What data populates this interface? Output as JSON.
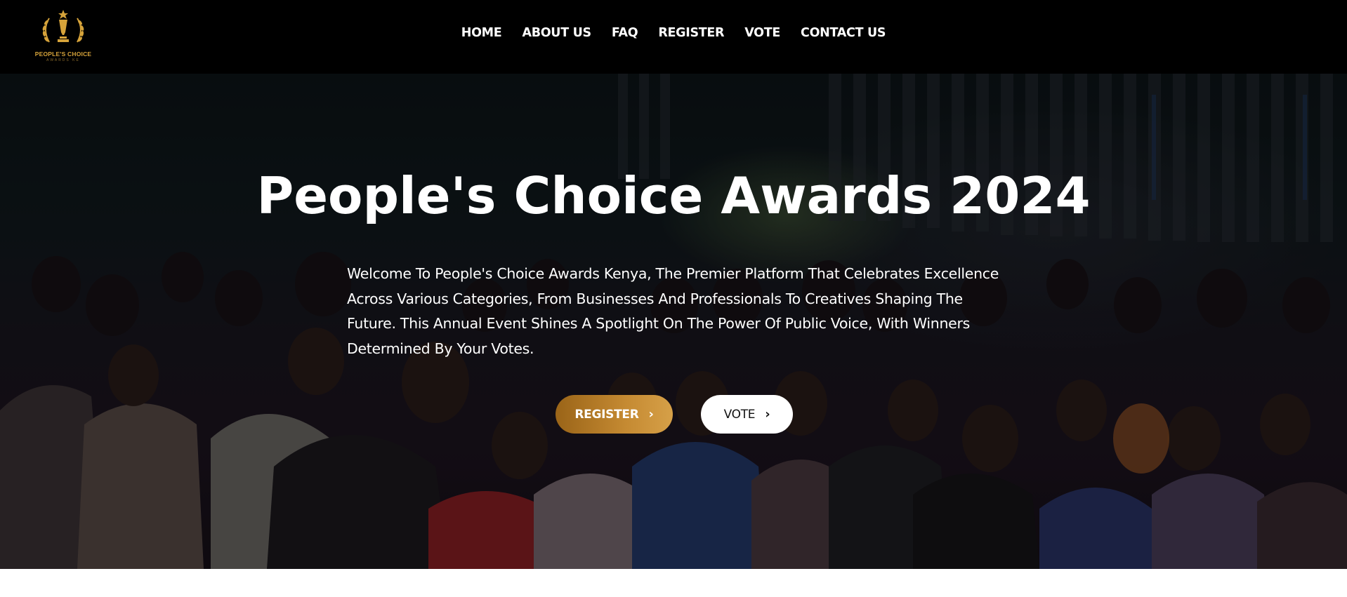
{
  "brand": {
    "logo_text": "PEOPLE'S CHOICE",
    "logo_subtext": "AWARDS KE",
    "gold": "#d6a33a"
  },
  "nav": {
    "items": [
      {
        "label": "HOME"
      },
      {
        "label": "ABOUT US"
      },
      {
        "label": "FAQ"
      },
      {
        "label": "REGISTER"
      },
      {
        "label": "VOTE"
      },
      {
        "label": "CONTACT US"
      }
    ]
  },
  "hero": {
    "title": "People's Choice Awards 2024",
    "description": "Welcome To People's Choice Awards Kenya, The Premier Platform That Celebrates Excellence Across Various Categories, From Businesses And Professionals To Creatives Shaping The Future. This Annual Event Shines A Spotlight On The Power Of Public Voice, With Winners Determined By Your Votes.",
    "register_label": "REGISTER",
    "vote_label": "VOTE",
    "chevron_icon": "chevron-right-icon",
    "register_color": "#c58a32"
  }
}
